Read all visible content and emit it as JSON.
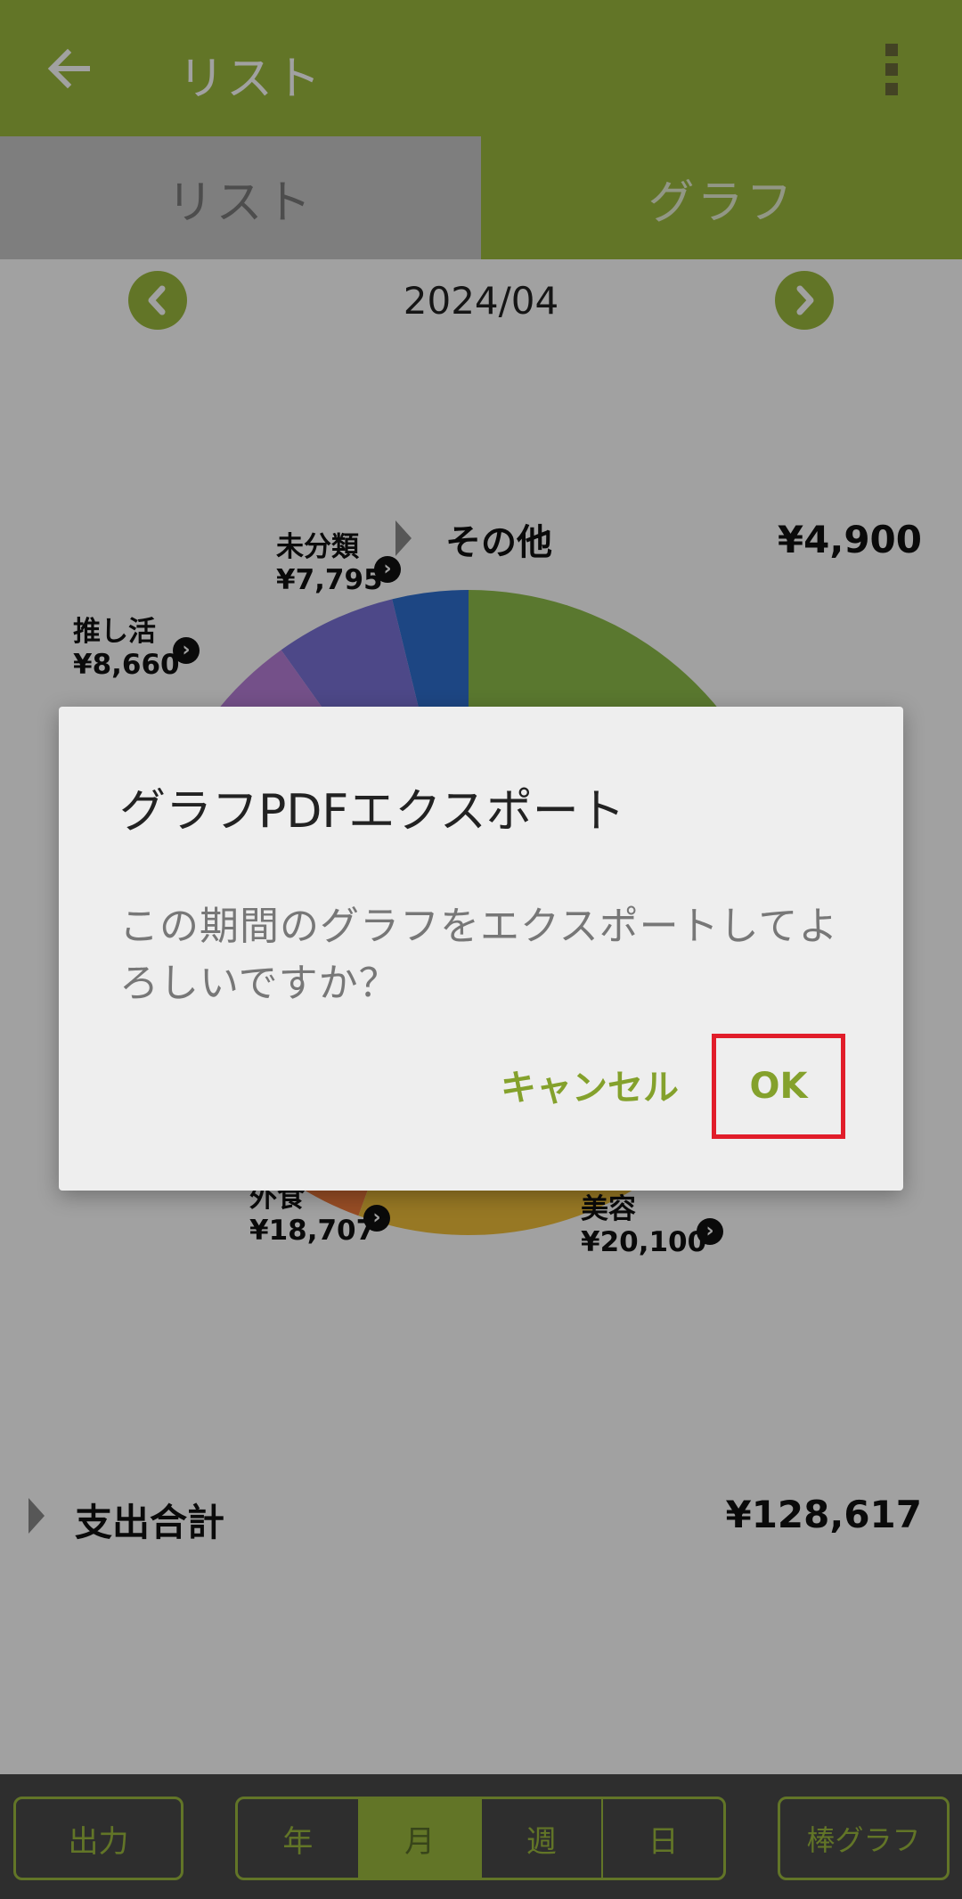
{
  "appbar": {
    "title": "リスト",
    "back_icon": "arrow-left-icon",
    "menu_icon": "more-vert-icon"
  },
  "tabs": [
    {
      "label": "リスト"
    },
    {
      "label": "グラフ"
    }
  ],
  "period": {
    "label": "2024/04"
  },
  "legend": {
    "other": {
      "name": "その他",
      "amount": "¥4,900"
    }
  },
  "slice_labels": [
    {
      "name": "未分類",
      "amount": "¥7,795"
    },
    {
      "name": "推し活",
      "amount": "¥8,660"
    },
    {
      "name": "外食",
      "amount": "¥18,707"
    },
    {
      "name": "美容",
      "amount": "¥20,100"
    }
  ],
  "chart_data": {
    "type": "pie",
    "title": "",
    "slices": [
      {
        "name": "その他",
        "value": 4900,
        "color": "#2e6fd0"
      },
      {
        "name": "未分類",
        "value": 7795,
        "color": "#7a72d8"
      },
      {
        "name": "推し活",
        "value": 8660,
        "color": "#b87fd9"
      },
      {
        "name": "外食",
        "value": 18707,
        "color": "#f07a3c"
      },
      {
        "name": "美容",
        "value": 20100,
        "color": "#f0bf3a"
      }
    ],
    "unlabeled_visible_colors": [
      "#8fbe4b"
    ],
    "total": 128617
  },
  "total": {
    "label": "支出合計",
    "amount": "¥128,617"
  },
  "bottom": {
    "output": "出力",
    "seg": [
      "年",
      "月",
      "週",
      "日"
    ],
    "bar_graph": "棒グラフ"
  },
  "dialog": {
    "title": "グラフPDFエクスポート",
    "message": "この期間のグラフをエクスポートしてよろしいですか？",
    "cancel": "キャンセル",
    "ok": "OK"
  },
  "colors": {
    "accent": "#9bba3e",
    "dialog_button": "#84a12c",
    "highlight": "#e11d2a"
  }
}
